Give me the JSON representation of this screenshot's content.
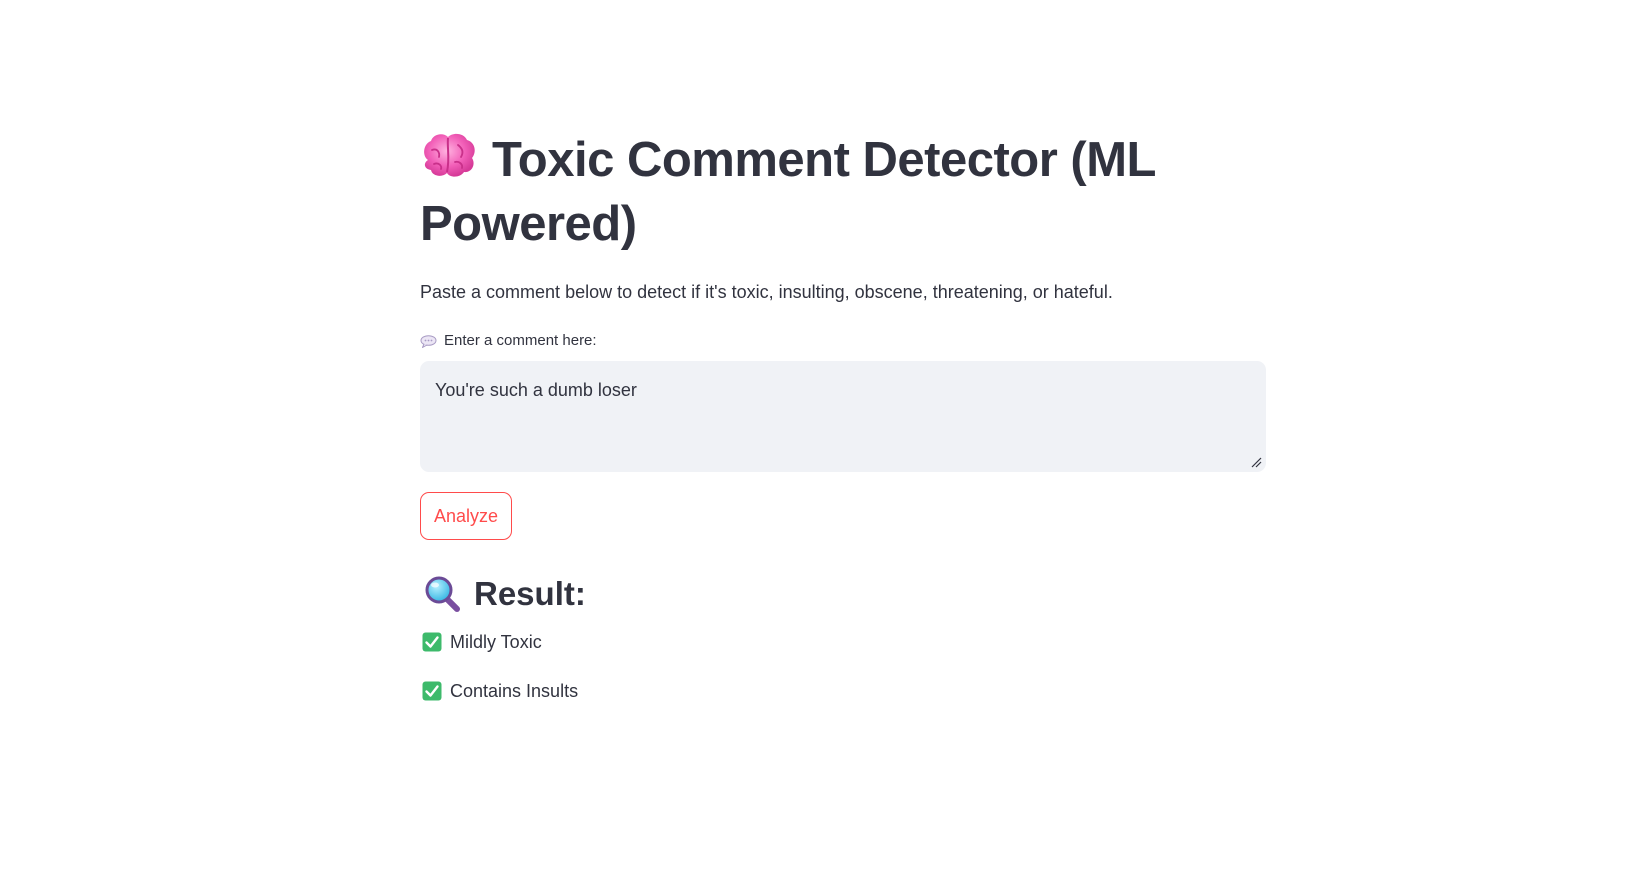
{
  "app": {
    "title": "Toxic Comment Detector (ML Powered)",
    "title_icon": "brain-icon",
    "subtitle": "Paste a comment below to detect if it's toxic, insulting, obscene, threatening, or hateful."
  },
  "comment_input": {
    "label": "Enter a comment here:",
    "label_icon": "speech-bubble-icon",
    "value": "You're such a dumb loser"
  },
  "analyze_button": {
    "label": "Analyze"
  },
  "result": {
    "heading": "Result:",
    "heading_icon": "magnifying-glass-icon",
    "items": [
      {
        "label": "Mildly Toxic",
        "icon": "check-mark-icon"
      },
      {
        "label": "Contains Insults",
        "icon": "check-mark-icon"
      }
    ]
  },
  "colors": {
    "text": "#31333f",
    "accent": "#ff4b4b",
    "input_background": "#f0f2f6",
    "check_green": "#3dba6b"
  }
}
